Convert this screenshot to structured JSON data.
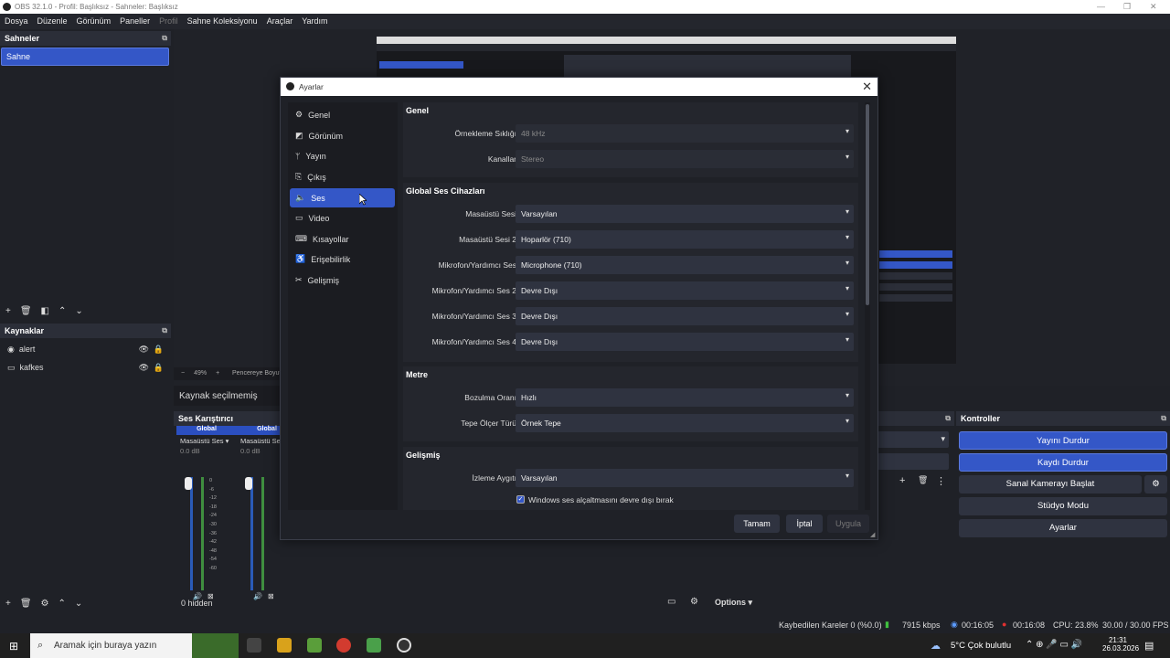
{
  "window": {
    "title": "OBS 32.1.0 - Profil: Başlıksız - Sahneler: Başlıksız"
  },
  "menu": [
    {
      "label": "Dosya",
      "dim": false
    },
    {
      "label": "Düzenle",
      "dim": false
    },
    {
      "label": "Görünüm",
      "dim": false
    },
    {
      "label": "Paneller",
      "dim": false
    },
    {
      "label": "Profil",
      "dim": true
    },
    {
      "label": "Sahne Koleksiyonu",
      "dim": false
    },
    {
      "label": "Araçlar",
      "dim": false
    },
    {
      "label": "Yardım",
      "dim": false
    }
  ],
  "scenes": {
    "title": "Sahneler",
    "items": [
      "Sahne"
    ]
  },
  "sources": {
    "title": "Kaynaklar",
    "items": [
      "alert",
      "kafkes"
    ]
  },
  "preview": {
    "zoom": "49%",
    "fit_label": "Pencereye Boyutla"
  },
  "source_props": {
    "label": "Kaynak seçilmemiş"
  },
  "mixer": {
    "title": "Ses Karıştırıcı",
    "channels": [
      {
        "group": "Global",
        "name": "Masaüstü Ses",
        "db": "0.0 dB"
      },
      {
        "group": "Global",
        "name": "Masaüstü Ses",
        "db": "0.0 dB"
      }
    ],
    "scale": [
      "0",
      "-6",
      "-12",
      "-18",
      "-24",
      "-30",
      "-36",
      "-42",
      "-48",
      "-54",
      "-60"
    ],
    "hidden": "0 hidden",
    "options": "Options"
  },
  "controls": {
    "title": "Kontroller",
    "buttons": [
      "Yayını Durdur",
      "Kaydı Durdur",
      "Sanal Kamerayı Başlat",
      "Stüdyo Modu",
      "Ayarlar"
    ]
  },
  "status": {
    "dropped": "Kaybedilen Kareler 0 (%0.0)",
    "kbps": "7915 kbps",
    "stream_time": "00:16:05",
    "rec_time": "00:16:08",
    "cpu": "CPU: 23.8%",
    "fps": "30.00 / 30.00 FPS"
  },
  "taskbar": {
    "search_placeholder": "Aramak için buraya yazın",
    "weather": "5°C  Çok bulutlu",
    "time": "21:31",
    "date": "26.03.2026"
  },
  "dialog": {
    "title": "Ayarlar",
    "sidebar": [
      {
        "label": "Genel",
        "icon": "gear-icon"
      },
      {
        "label": "Görünüm",
        "icon": "appearance-icon"
      },
      {
        "label": "Yayın",
        "icon": "antenna-icon"
      },
      {
        "label": "Çıkış",
        "icon": "output-icon"
      },
      {
        "label": "Ses",
        "icon": "speaker-icon"
      },
      {
        "label": "Video",
        "icon": "monitor-icon"
      },
      {
        "label": "Kısayollar",
        "icon": "keyboard-icon"
      },
      {
        "label": "Erişebilirlik",
        "icon": "accessibility-icon"
      },
      {
        "label": "Gelişmiş",
        "icon": "wrench-icon"
      }
    ],
    "active_index": 4,
    "sections": {
      "genel": {
        "title": "Genel",
        "rows": [
          {
            "label": "Örnekleme Sıklığı",
            "value": "48 kHz",
            "disabled": true
          },
          {
            "label": "Kanallar",
            "value": "Stereo",
            "disabled": true
          }
        ]
      },
      "devices": {
        "title": "Global Ses Cihazları",
        "rows": [
          {
            "label": "Masaüstü Sesi",
            "value": "Varsayılan"
          },
          {
            "label": "Masaüstü Sesi 2",
            "value": "Hoparlör (710)"
          },
          {
            "label": "Mikrofon/Yardımcı Ses",
            "value": "Microphone (710)"
          },
          {
            "label": "Mikrofon/Yardımcı Ses 2",
            "value": "Devre Dışı"
          },
          {
            "label": "Mikrofon/Yardımcı Ses 3",
            "value": "Devre Dışı"
          },
          {
            "label": "Mikrofon/Yardımcı Ses 4",
            "value": "Devre Dışı"
          }
        ]
      },
      "metre": {
        "title": "Metre",
        "rows": [
          {
            "label": "Bozulma Oranı",
            "value": "Hızlı"
          },
          {
            "label": "Tepe Ölçer Türü",
            "value": "Örnek Tepe"
          }
        ]
      },
      "advanced": {
        "title": "Gelişmiş",
        "rows": [
          {
            "label": "İzleme Aygıtı",
            "value": "Varsayılan"
          }
        ],
        "checkbox": "Windows ses alçaltmasını devre dışı bırak"
      }
    },
    "buttons": {
      "ok": "Tamam",
      "cancel": "İptal",
      "apply": "Uygula"
    }
  }
}
